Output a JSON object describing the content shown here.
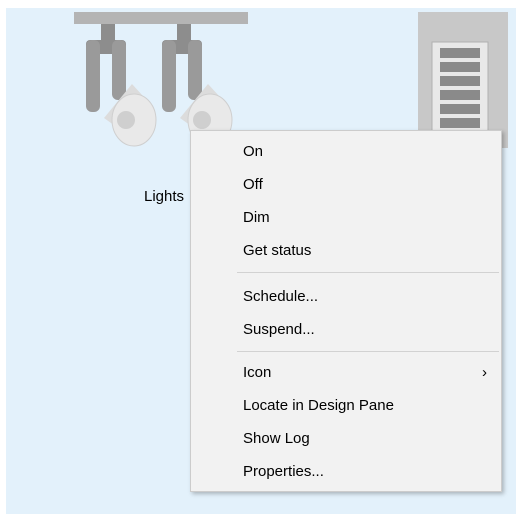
{
  "device": {
    "label": "Lights",
    "icon": "track-lights-icon"
  },
  "switch": {
    "icon": "wall-switch-icon"
  },
  "context_menu": {
    "items": [
      {
        "label": "On"
      },
      {
        "label": "Off"
      },
      {
        "label": "Dim"
      },
      {
        "label": "Get status"
      },
      {
        "label": "Schedule..."
      },
      {
        "label": "Suspend..."
      },
      {
        "label": "Icon",
        "submenu_arrow": "›"
      },
      {
        "label": "Locate in Design Pane"
      },
      {
        "label": "Show Log"
      },
      {
        "label": "Properties..."
      }
    ]
  }
}
